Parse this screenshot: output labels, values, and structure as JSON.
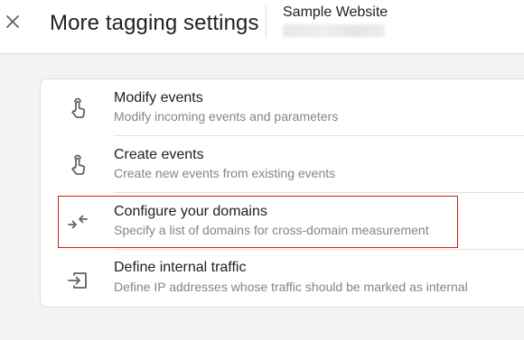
{
  "header": {
    "title": "More tagging settings",
    "site_name": "Sample Website",
    "close_icon": "close-icon"
  },
  "settings": [
    {
      "label": "Modify events",
      "description": "Modify incoming events and parameters",
      "icon": "touch-icon"
    },
    {
      "label": "Create events",
      "description": "Create new events from existing events",
      "icon": "touch-icon"
    },
    {
      "label": "Configure your domains",
      "description": "Specify a list of domains for cross-domain measurement",
      "icon": "arrows-inward-icon"
    },
    {
      "label": "Define internal traffic",
      "description": "Define IP addresses whose traffic should be marked as internal",
      "icon": "input-icon"
    }
  ],
  "colors": {
    "highlight_border": "#c5221f",
    "icon": "#5f6368",
    "background": "#f1f3f4"
  }
}
